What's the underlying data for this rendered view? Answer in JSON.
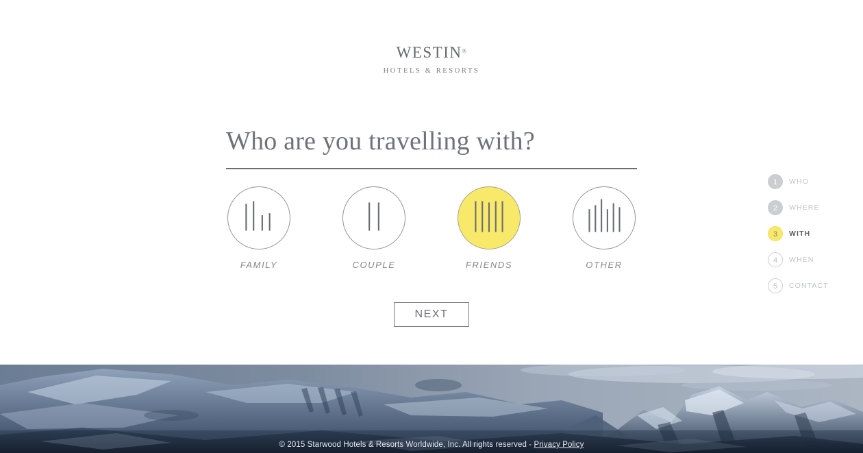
{
  "brand": {
    "logo_word": "Westin",
    "logo_registered": "®",
    "logo_subtitle": "HOTELS & RESORTS",
    "logo_color": "#66696f",
    "accent_color": "#f8e96b"
  },
  "main": {
    "heading": "Who are you travelling with?",
    "next_label": "NEXT",
    "options": [
      {
        "id": "family",
        "label": "FAMILY",
        "selected": false,
        "icon": "four-bars-family-icon",
        "bars": 4
      },
      {
        "id": "couple",
        "label": "COUPLE",
        "selected": false,
        "icon": "two-bars-couple-icon",
        "bars": 2
      },
      {
        "id": "friends",
        "label": "FRIENDS",
        "selected": true,
        "icon": "five-bars-friends-icon",
        "bars": 5
      },
      {
        "id": "other",
        "label": "OTHER",
        "selected": false,
        "icon": "six-bars-other-icon",
        "bars": 6
      }
    ]
  },
  "stepper": {
    "steps": [
      {
        "number": "1",
        "label": "WHO",
        "state": "done"
      },
      {
        "number": "2",
        "label": "WHERE",
        "state": "done"
      },
      {
        "number": "3",
        "label": "WITH",
        "state": "active"
      },
      {
        "number": "4",
        "label": "WHEN",
        "state": "todo"
      },
      {
        "number": "5",
        "label": "CONTACT",
        "state": "todo"
      }
    ]
  },
  "footer": {
    "copyright": "© 2015 Starwood Hotels & Resorts Worldwide, Inc. All rights reserved - ",
    "privacy_link": "Privacy Policy",
    "hero_alt": "snow-covered-mountain-range-photo"
  }
}
